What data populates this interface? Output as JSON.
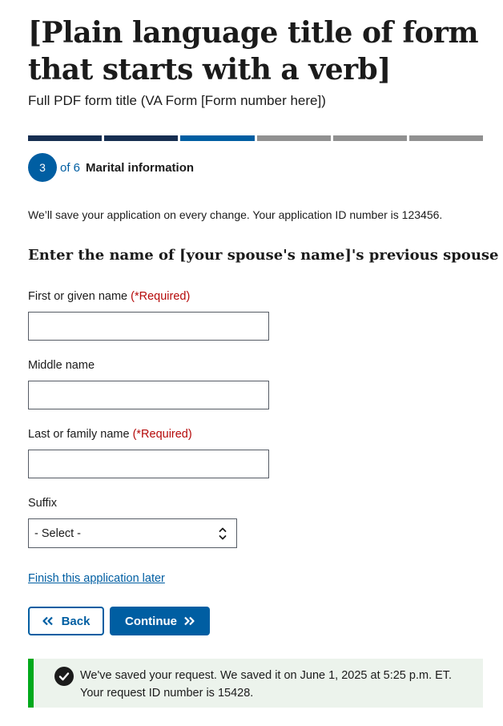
{
  "header": {
    "title": "[Plain language title of form that starts with a verb]",
    "subtitle": "Full PDF form title (VA Form [Form number here])"
  },
  "progress": {
    "total_segments": 6,
    "completed_segments": 2,
    "current_segment": 3,
    "colors": {
      "completed": "#162e51",
      "current": "#005ea2",
      "incomplete": "#919191"
    }
  },
  "step": {
    "number": "3",
    "of_text": "of 6",
    "name": "Marital information"
  },
  "save_note": "We’ll save your application on every change. Your application ID number is 123456.",
  "form": {
    "heading": "Enter the name of [your spouse's name]'s previous spouse",
    "required_text": "(*Required)",
    "first_name": {
      "label": "First or given name",
      "value": ""
    },
    "middle_name": {
      "label": "Middle name",
      "value": ""
    },
    "last_name": {
      "label": "Last or family name",
      "value": ""
    },
    "suffix": {
      "label": "Suffix",
      "selected": "- Select -"
    }
  },
  "links": {
    "finish_later": "Finish this application later"
  },
  "buttons": {
    "back_label": "Back",
    "continue_label": "Continue"
  },
  "alert": {
    "line1": "We've saved your request. We saved it on June 1, 2025 at 5:25 p.m. ET.",
    "line2": "Your request ID number is 15428."
  },
  "colors": {
    "primary": "#005ea2",
    "error": "#b50909",
    "success": "#00a91c",
    "success_bg": "#ecf3ec"
  },
  "icons": {
    "back": "double-chevron-left-icon",
    "continue": "double-chevron-right-icon",
    "select": "unfold-icon",
    "alert": "check-circle-icon"
  }
}
